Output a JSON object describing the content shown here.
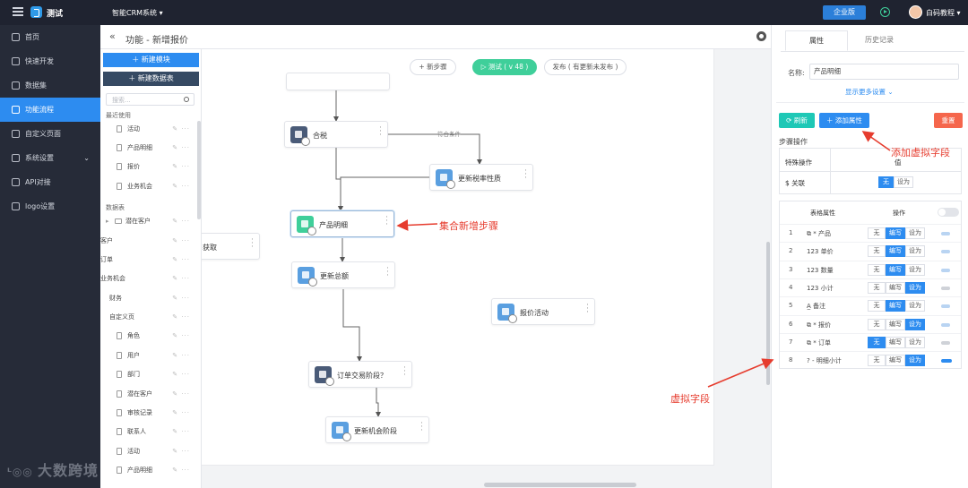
{
  "topbar": {
    "app_name": "测试",
    "system_name": "智能CRM系统",
    "system_caret": "▾",
    "enterprise_button": "企业版",
    "user_name": "白码教程",
    "user_caret": "▾"
  },
  "sidebar": {
    "items": [
      {
        "label": "首页"
      },
      {
        "label": "快速开发"
      },
      {
        "label": "数据集"
      },
      {
        "label": "功能流程"
      },
      {
        "label": "自定义页面"
      },
      {
        "label": "系统设置"
      },
      {
        "label": "API对接"
      },
      {
        "label": "logo设置"
      }
    ],
    "active_index": 3
  },
  "canvas_header": {
    "back": "«",
    "title": "功能 - 新增报价"
  },
  "tree": {
    "new_module": "＋  新建模块",
    "new_table": "＋  新建数据表",
    "search_placeholder": "搜索...",
    "recent_label": "最近使用",
    "recent": [
      "活动",
      "产品明细",
      "报价",
      "业务机会"
    ],
    "tables_label": "数据表",
    "tables": [
      "潜在客户",
      "客户",
      "订单",
      "业务机会",
      "财务",
      "自定义页"
    ],
    "custom_children": [
      "角色",
      "用户",
      "部门",
      "潜在客户",
      "审核记录",
      "联系人",
      "活动",
      "产品明细"
    ],
    "tool_glyph": "✎ ···"
  },
  "canvas": {
    "add_step": "+ 新步骤",
    "test_button": "▷ 测试 ( v 48 )",
    "publish_button": "发布 ( 有更新未发布 )",
    "condition_label": "符合条件",
    "nodes": [
      {
        "id": "hidden_top",
        "label": ""
      },
      {
        "id": "heji",
        "label": "合税"
      },
      {
        "id": "rate",
        "label": "更新税率性质"
      },
      {
        "id": "product",
        "label": "产品明细"
      },
      {
        "id": "fetch",
        "label": "获取"
      },
      {
        "id": "total",
        "label": "更新总额"
      },
      {
        "id": "quote_act",
        "label": "报价活动"
      },
      {
        "id": "stage",
        "label": "订单交易阶段？"
      },
      {
        "id": "opp",
        "label": "更新机会阶段"
      }
    ]
  },
  "panel": {
    "tabs": [
      "属性",
      "历史记录"
    ],
    "name_label": "名称:",
    "name_value": "产品明细",
    "more_settings": "显示更多设置 ⌄",
    "refresh": "⟳ 刷新",
    "add_attr": "＋ 添加属性",
    "reset": "重置",
    "step_ops": "步骤操作",
    "special_header": "特殊操作",
    "value_header": "值",
    "special_row_label": "$ 关联",
    "special_seg": [
      "无",
      "设为"
    ],
    "table_attr_header": "表格属性",
    "op_header": "操作",
    "seg_labels": [
      "无",
      "编写",
      "设为"
    ],
    "rows": [
      {
        "num": "1",
        "name": "⧉ * 产品",
        "op_index": 1,
        "mini": "on"
      },
      {
        "num": "2",
        "name": "123 单价",
        "op_index": 1,
        "mini": "on"
      },
      {
        "num": "3",
        "name": "123 数量",
        "op_index": 1,
        "mini": "on"
      },
      {
        "num": "4",
        "name": "123 小计",
        "op_index": 2,
        "mini": "off"
      },
      {
        "num": "5",
        "name": "A̲ 备注",
        "op_index": 1,
        "mini": "on"
      },
      {
        "num": "6",
        "name": "⧉ * 报价",
        "op_index": 2,
        "mini": "on"
      },
      {
        "num": "7",
        "name": "⧉ * 订单",
        "op_index": 0,
        "mini": "off"
      },
      {
        "num": "8",
        "name": "? - 明细小计",
        "op_index": 2,
        "mini": "strong"
      }
    ]
  },
  "annotations": {
    "add_virtual_field": "添加虚拟字段",
    "set_new_step": "集合新增步骤",
    "virtual_field": "虚拟字段"
  },
  "watermark": "大数跨境",
  "colors": {
    "accent": "#2d8cf0",
    "green": "#3fcf9a",
    "annotation": "#e63c2e",
    "sidebar_bg": "#262b38"
  }
}
